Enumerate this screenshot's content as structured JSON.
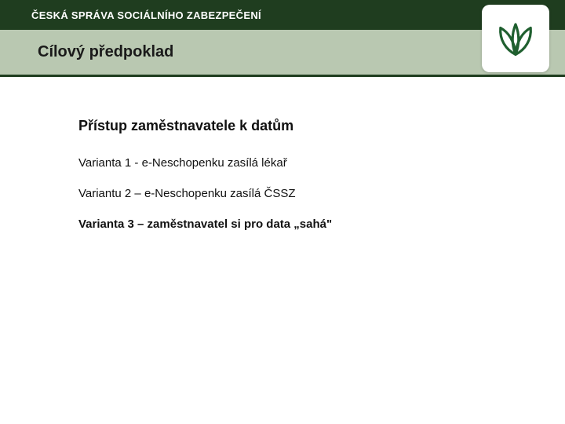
{
  "header": {
    "org_name": "ČESKÁ SPRÁVA SOCIÁLNÍHO ZABEZPEČENÍ",
    "subtitle": "Cílový předpoklad"
  },
  "content": {
    "heading": "Přístup zaměstnavatele k datům",
    "items": [
      {
        "text": "Varianta 1 - e-Neschopenku zasílá lékař",
        "bold": false
      },
      {
        "text": "Variantu 2 – e-Neschopenku zasílá ČSSZ",
        "bold": false
      },
      {
        "text": "Varianta 3 – zaměstnavatel si pro data „sahá\"",
        "bold": true
      }
    ]
  }
}
